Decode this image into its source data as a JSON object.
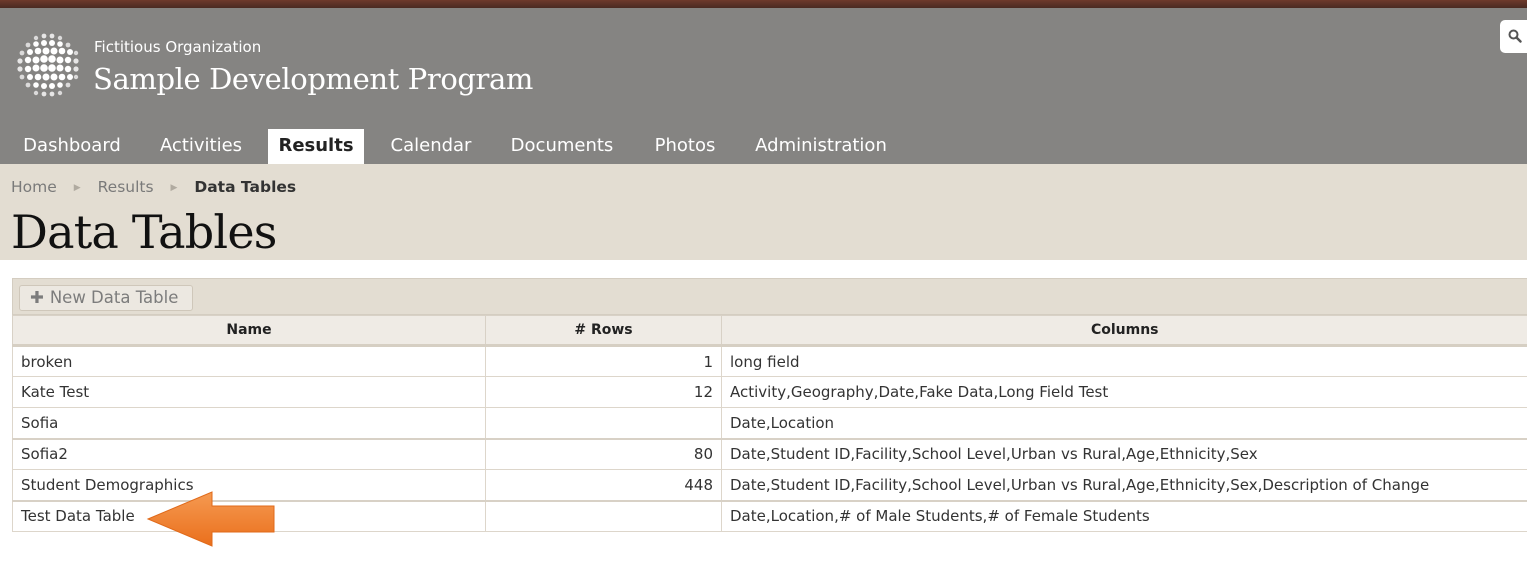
{
  "header": {
    "org_name": "Fictitious Organization",
    "site_title": "Sample Development Program"
  },
  "nav": {
    "items": [
      {
        "label": "Dashboard"
      },
      {
        "label": "Activities"
      },
      {
        "label": "Results",
        "active": true
      },
      {
        "label": "Calendar"
      },
      {
        "label": "Documents"
      },
      {
        "label": "Photos"
      },
      {
        "label": "Administration"
      }
    ]
  },
  "breadcrumb": {
    "home": "Home",
    "parent": "Results",
    "current": "Data Tables"
  },
  "page": {
    "title": "Data Tables",
    "new_button_label": "New Data Table"
  },
  "table": {
    "headers": {
      "name": "Name",
      "rows": "# Rows",
      "columns": "Columns"
    },
    "rows": [
      {
        "name": "broken",
        "rows": "1",
        "columns": "long field"
      },
      {
        "name": "Kate Test",
        "rows": "12",
        "columns": "Activity,Geography,Date,Fake Data,Long Field Test"
      },
      {
        "name": "Sofia",
        "rows": "",
        "columns": "Date,Location"
      },
      {
        "name": "Sofia2",
        "rows": "80",
        "columns": "Date,Student ID,Facility,School Level,Urban vs Rural,Age,Ethnicity,Sex"
      },
      {
        "name": "Student Demographics",
        "rows": "448",
        "columns": "Date,Student ID,Facility,School Level,Urban vs Rural,Age,Ethnicity,Sex,Description of Change"
      },
      {
        "name": "Test Data Table",
        "rows": "",
        "columns": "Date,Location,# of Male Students,# of Female Students"
      }
    ]
  },
  "colors": {
    "header_bg": "#858482",
    "page_head_bg": "#e3ddd2",
    "arrow": "#f07f2a"
  }
}
